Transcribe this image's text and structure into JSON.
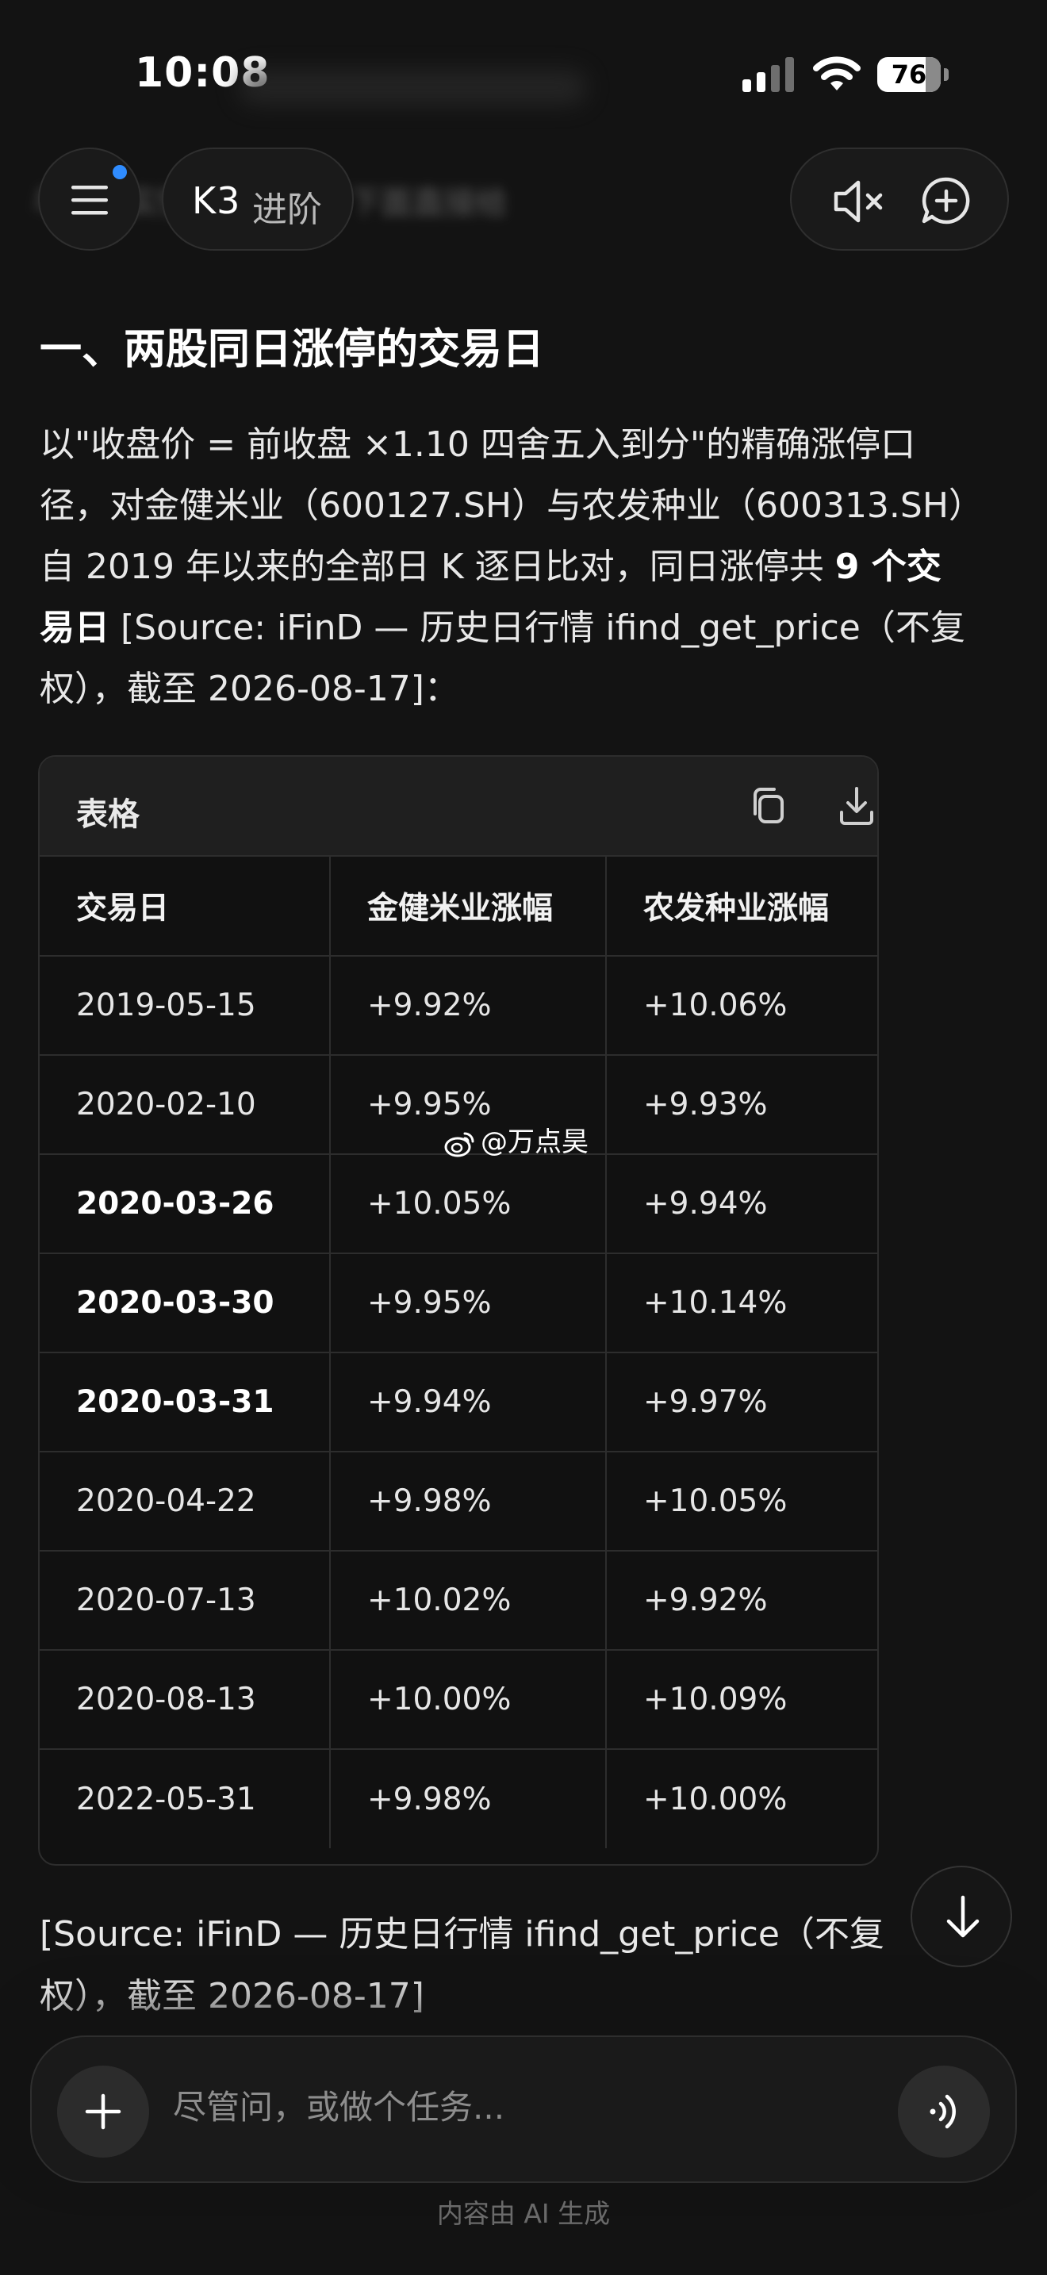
{
  "status_bar": {
    "time": "10:08",
    "battery": "76",
    "battery_level": 0.76,
    "icons": [
      "signal-icon",
      "wifi-icon",
      "battery-icon"
    ]
  },
  "nav": {
    "model_name": "K3",
    "model_tier": "进阶",
    "obscured_text": "与历史实情完全吻合，下面直接给",
    "icons": [
      "menu-icon",
      "speaker-muted-icon",
      "new-chat-icon"
    ],
    "accent": "#2f8cff"
  },
  "content": {
    "heading": "一、两股同日涨停的交易日",
    "paragraph_lines": [
      [
        {
          "t": "以\"收盘价 = 前收盘 ×1.10 四舍五入到分\"的精确涨停口"
        }
      ],
      [
        {
          "t": "径，对金健米业（600127.SH）与农发种业（600313.SH）"
        }
      ],
      [
        {
          "t": "自 2019 年以来的全部日 K 逐日比对，同日涨停共 "
        },
        {
          "t": "9 个交",
          "b": true
        }
      ],
      [
        {
          "t": "易日",
          "b": true
        },
        {
          "t": " [Source: iFinD — 历史日行情 ifind_get_price（不复"
        }
      ],
      [
        {
          "t": "权），截至 2026-08-17]："
        }
      ]
    ],
    "source_lines": [
      "[Source: iFinD — 历史日行情 ifind_get_price（不复",
      "权），截至 2026-08-17]"
    ]
  },
  "table": {
    "title": "表格",
    "icons": [
      "copy-icon",
      "download-icon"
    ],
    "columns": [
      "交易日",
      "金健米业涨幅",
      "农发种业涨幅"
    ],
    "rows": [
      {
        "date": "2019-05-15",
        "a": "+9.92%",
        "b": "+10.06%",
        "bold": false
      },
      {
        "date": "2020-02-10",
        "a": "+9.95%",
        "b": "+9.93%",
        "bold": false
      },
      {
        "date": "2020-03-26",
        "a": "+10.05%",
        "b": "+9.94%",
        "bold": true
      },
      {
        "date": "2020-03-30",
        "a": "+9.95%",
        "b": "+10.14%",
        "bold": true
      },
      {
        "date": "2020-03-31",
        "a": "+9.94%",
        "b": "+9.97%",
        "bold": true
      },
      {
        "date": "2020-04-22",
        "a": "+9.98%",
        "b": "+10.05%",
        "bold": false
      },
      {
        "date": "2020-07-13",
        "a": "+10.02%",
        "b": "+9.92%",
        "bold": false
      },
      {
        "date": "2020-08-13",
        "a": "+10.00%",
        "b": "+10.09%",
        "bold": false
      },
      {
        "date": "2022-05-31",
        "a": "+9.98%",
        "b": "+10.00%",
        "bold": false
      }
    ]
  },
  "watermark": {
    "text": "@万点昊",
    "icon": "weibo-icon"
  },
  "composer": {
    "placeholder": "尽管问，或做个任务...",
    "icons": [
      "plus-icon",
      "voice-icon",
      "arrow-down-icon"
    ]
  },
  "footer": {
    "note": "内容由 AI 生成"
  }
}
